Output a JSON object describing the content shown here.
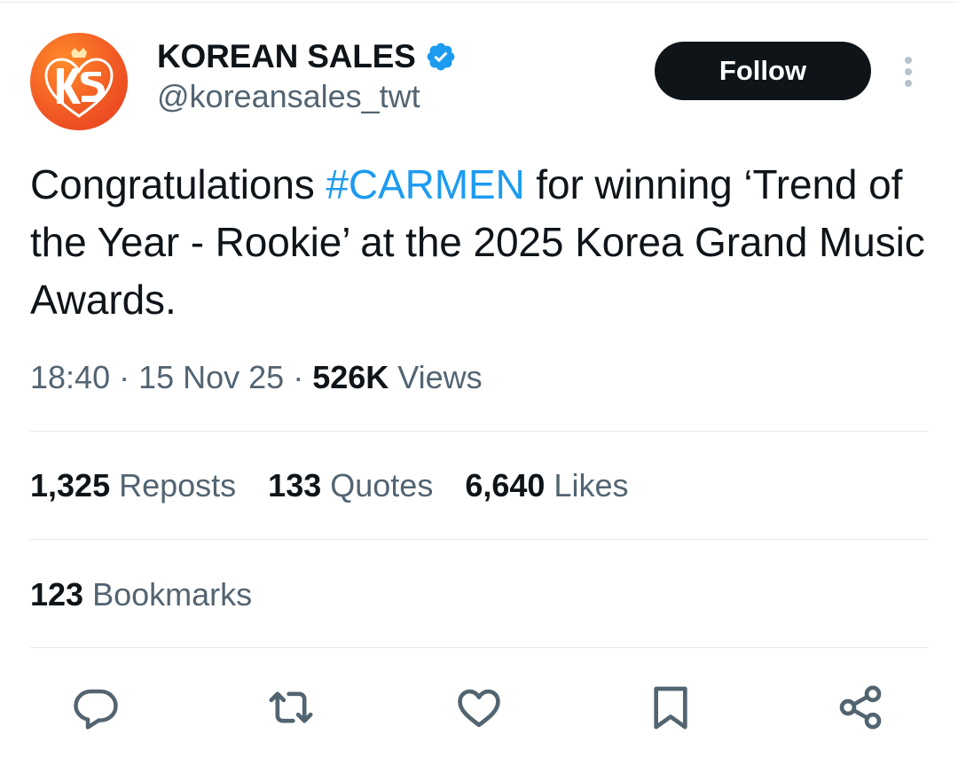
{
  "account": {
    "display_name": "KOREAN SALES",
    "handle": "@koreansales_twt",
    "avatar_icon": "ks-logo-icon",
    "verified_icon": "verified-badge-icon",
    "verified_color": "#1d9bf0",
    "avatar_color": "#f15a24"
  },
  "follow_button": {
    "label": "Follow"
  },
  "more_icon": "more-options-icon",
  "tweet": {
    "text_before": "Congratulations ",
    "hashtag": "#CARMEN",
    "text_after": " for winning ‘Trend of the Year - Rookie’ at the 2025 Korea Grand Music Awards.",
    "hashtag_color": "#1d9bf0"
  },
  "meta": {
    "time": "18:40",
    "sep1": " · ",
    "date": "15 Nov 25",
    "sep2": " · ",
    "views_count": "526K",
    "views_label": " Views"
  },
  "stats": {
    "reposts_count": "1,325",
    "reposts_label": " Reposts",
    "quotes_count": "133",
    "quotes_label": " Quotes",
    "likes_count": "6,640",
    "likes_label": " Likes",
    "bookmarks_count": "123",
    "bookmarks_label": " Bookmarks"
  },
  "actions": [
    {
      "name": "reply-icon"
    },
    {
      "name": "repost-icon"
    },
    {
      "name": "like-icon"
    },
    {
      "name": "bookmark-icon"
    },
    {
      "name": "share-icon"
    }
  ],
  "colors": {
    "text_primary": "#0f1419",
    "text_secondary": "#536471",
    "divider": "#e6e9ec",
    "follow_bg": "#0f1419"
  }
}
